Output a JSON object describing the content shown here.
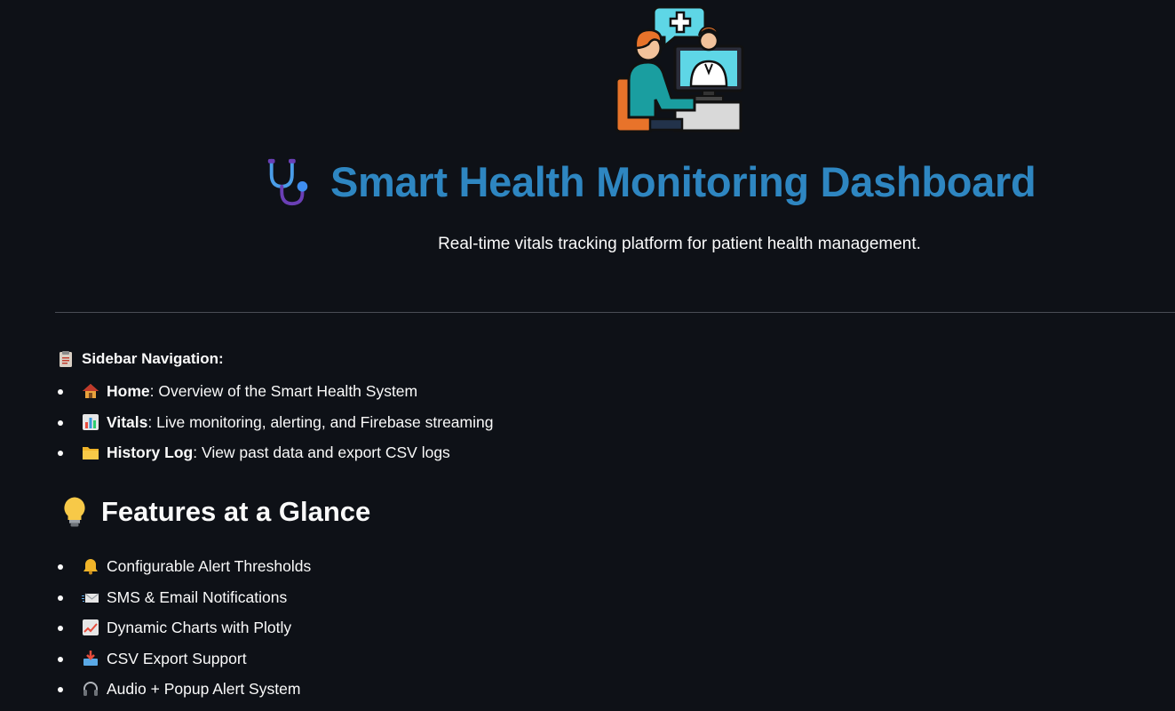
{
  "header": {
    "title": "Smart Health Monitoring Dashboard",
    "subtitle": "Real-time vitals tracking platform for patient health management.",
    "title_color": "#2e86c1",
    "title_icon": "stethoscope-icon",
    "hero_image": "telemedicine-doctor-illustration"
  },
  "navigation": {
    "heading": "Sidebar Navigation:",
    "heading_icon": "clipboard-icon",
    "items": [
      {
        "label": "Home",
        "desc": ": Overview of the Smart Health System",
        "icon": "house-icon"
      },
      {
        "label": "Vitals",
        "desc": ": Live monitoring, alerting, and Firebase streaming",
        "icon": "bar-chart-icon"
      },
      {
        "label": "History Log",
        "desc": ": View past data and export CSV logs",
        "icon": "folder-icon"
      }
    ]
  },
  "features": {
    "heading": "Features at a Glance",
    "heading_icon": "lightbulb-icon",
    "items": [
      {
        "label": "Configurable Alert Thresholds",
        "icon": "bell-icon"
      },
      {
        "label": "SMS & Email Notifications",
        "icon": "envelope-icon"
      },
      {
        "label": "Dynamic Charts with Plotly",
        "icon": "trending-chart-icon"
      },
      {
        "label": "CSV Export Support",
        "icon": "inbox-tray-icon"
      },
      {
        "label": "Audio + Popup Alert System",
        "icon": "headphones-icon"
      }
    ]
  },
  "colors": {
    "background": "#0e1117",
    "text": "#fafafa",
    "accent": "#2e86c1",
    "divider": "#4a4d55"
  }
}
